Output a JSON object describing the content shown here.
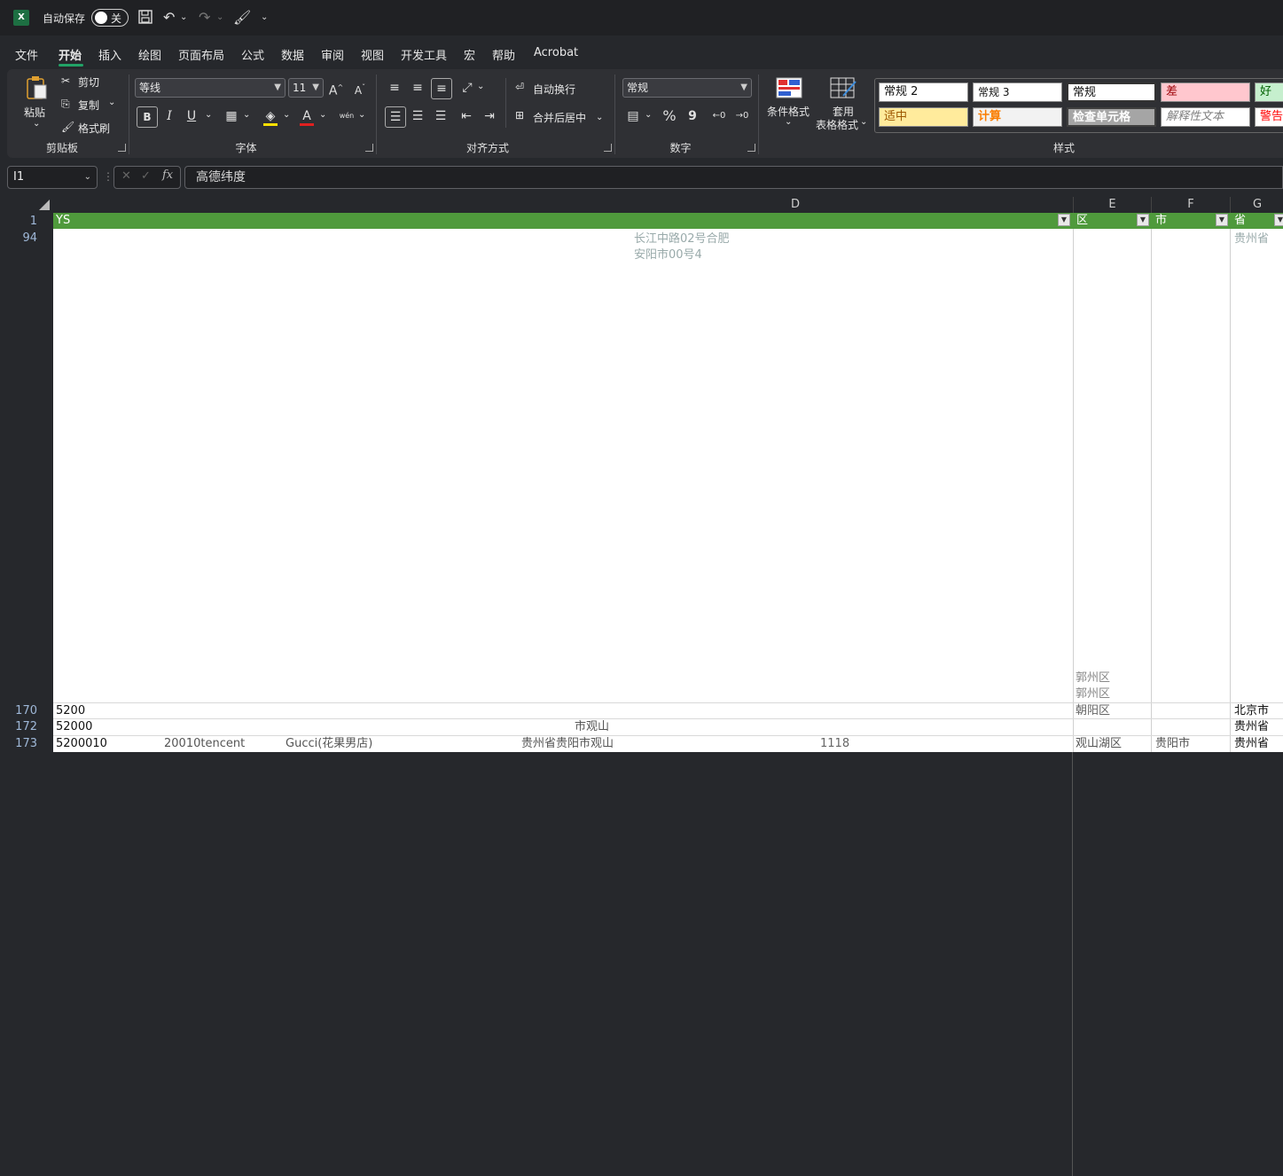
{
  "titlebar": {
    "autosave_label": "自动保存",
    "autosave_state": "关",
    "app_icon": "X"
  },
  "menu": [
    "文件",
    "开始",
    "插入",
    "绘图",
    "页面布局",
    "公式",
    "数据",
    "审阅",
    "视图",
    "开发工具",
    "宏",
    "帮助",
    "Acrobat"
  ],
  "ribbon": {
    "clipboard": {
      "paste": "粘贴",
      "cut": "剪切",
      "copy": "复制",
      "format_painter": "格式刷",
      "label": "剪贴板"
    },
    "font": {
      "name": "等线",
      "size": "11",
      "label": "字体",
      "bold": "B",
      "italic": "I",
      "underline": "U",
      "grow": "A",
      "shrink": "A",
      "font_color": "A",
      "phonetic": "wén"
    },
    "alignment": {
      "wrap": "自动换行",
      "merge": "合并后居中",
      "label": "对齐方式"
    },
    "number": {
      "format": "常规",
      "label": "数字",
      "percent": "%",
      "comma": "9"
    },
    "styles": {
      "conditional": "条件格式",
      "table_line1": "套用",
      "table_line2": "表格格式",
      "label": "样式",
      "cells": [
        "常规 2",
        "常规 3",
        "常规",
        "差",
        "好",
        "适中",
        "计算",
        "检查单元格",
        "解释性文本",
        "警告"
      ]
    }
  },
  "formula_bar": {
    "name_box": "I1",
    "fx": "fx",
    "content": "高德纬度"
  },
  "columns": [
    "D",
    "E",
    "F",
    "G"
  ],
  "rows": {
    "numbers": [
      "1",
      "94",
      "170",
      "172",
      "173"
    ],
    "header": {
      "a": "YS",
      "e": "区",
      "f": "市",
      "g": "省"
    },
    "r94": {
      "d": "长江中路02号合肥",
      "d2": "安阳市00号4",
      "g": "贵州省"
    },
    "r170": {
      "a": "5200",
      "g": "北京市"
    },
    "r172": {
      "a": "52000",
      "d": "市观山",
      "g": "贵州省"
    },
    "r173": {
      "a": "5200010",
      "b": "20010tencent",
      "c": "Gucci(花果男店)",
      "d": "贵州省贵阳市观山",
      "dd": "1118",
      "e": "观山湖区",
      "f": "贵阳市",
      "g": "贵州省"
    },
    "e_stray": [
      "郭州区",
      "郭州区",
      "朝阳区"
    ]
  },
  "colors": {
    "accent": "#21a366",
    "header_green": "#4f9a3c"
  }
}
